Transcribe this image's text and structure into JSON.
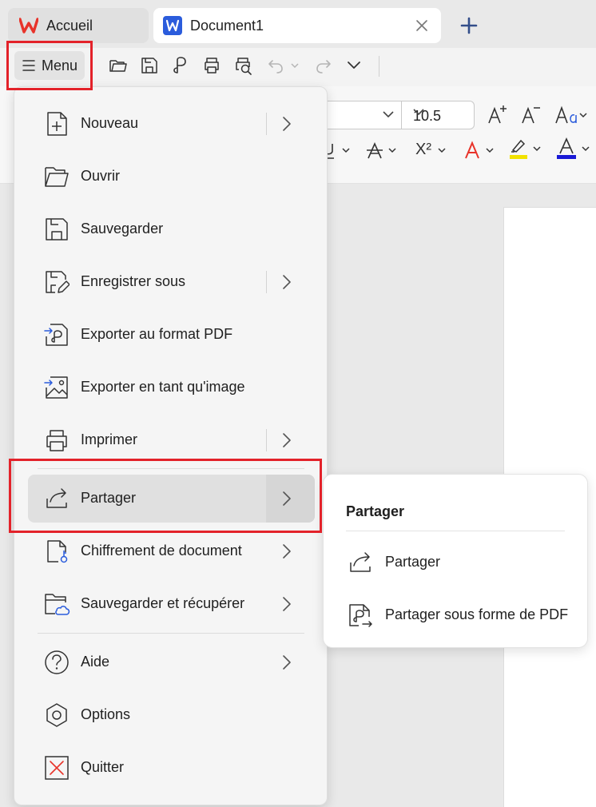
{
  "tabs": [
    {
      "label": "Accueil"
    },
    {
      "label": "Document1"
    }
  ],
  "toolbar": {
    "menu_label": "Menu"
  },
  "ribbon": {
    "font_size": "10.5",
    "superscript_label": "X²"
  },
  "menu": {
    "items": [
      {
        "label": "Nouveau",
        "icon": "new-document-icon",
        "has_submenu": true
      },
      {
        "label": "Ouvrir",
        "icon": "folder-open-icon",
        "has_submenu": false
      },
      {
        "label": "Sauvegarder",
        "icon": "save-icon",
        "has_submenu": false
      },
      {
        "label": "Enregistrer sous",
        "icon": "save-as-icon",
        "has_submenu": true
      },
      {
        "label": "Exporter au format PDF",
        "icon": "export-pdf-icon",
        "has_submenu": false
      },
      {
        "label": "Exporter en tant qu'image",
        "icon": "export-image-icon",
        "has_submenu": false
      },
      {
        "label": "Imprimer",
        "icon": "printer-icon",
        "has_submenu": true
      },
      {
        "label": "Partager",
        "icon": "share-icon",
        "has_submenu": true,
        "active": true
      },
      {
        "label": "Chiffrement de document",
        "icon": "encrypt-document-icon",
        "has_submenu": true
      },
      {
        "label": "Sauvegarder et récupérer",
        "icon": "cloud-backup-icon",
        "has_submenu": true
      },
      {
        "label": "Aide",
        "icon": "help-icon",
        "has_submenu": true
      },
      {
        "label": "Options",
        "icon": "options-icon",
        "has_submenu": false
      },
      {
        "label": "Quitter",
        "icon": "quit-icon",
        "has_submenu": false
      }
    ]
  },
  "submenu": {
    "title": "Partager",
    "items": [
      {
        "label": "Partager",
        "icon": "share-icon"
      },
      {
        "label": "Partager sous forme de PDF",
        "icon": "share-pdf-icon"
      }
    ]
  },
  "colors": {
    "highlight_box": "#e3222a",
    "brand_red": "#e8332a",
    "word_blue": "#2b5cdc",
    "highlight_yellow": "#f2e200",
    "font_color_blue": "#1a1ad6"
  }
}
